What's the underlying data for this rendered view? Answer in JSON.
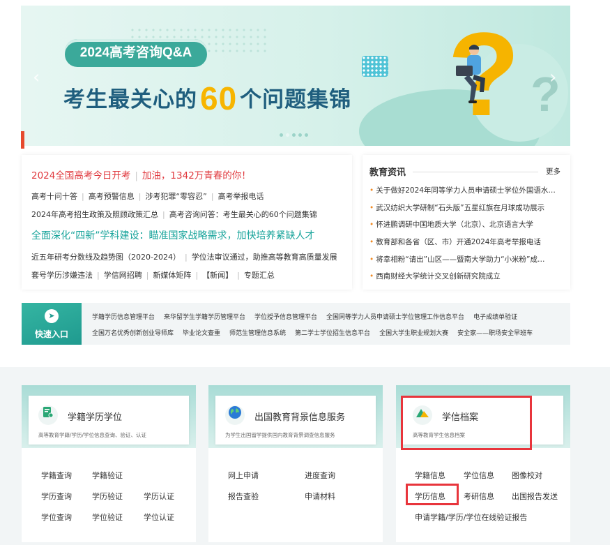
{
  "banner": {
    "tag": "2024高考咨询Q&A",
    "title_pre": "考生最关心的",
    "title_num": "60",
    "title_post": "个问题集锦",
    "prev": "‹",
    "next": "›",
    "slide_count": 5,
    "active_slide": 2
  },
  "news": {
    "headline1_a": "2024全国高考今日开考",
    "headline1_sep": "|",
    "headline1_b": "加油，1342万青春的你！",
    "row1": [
      "高考十问十答",
      "高考预警信息",
      "涉考犯罪“零容忍”",
      "高考举报电话"
    ],
    "row2": [
      "2024年高考招生政策及照顾政策汇总",
      "高考咨询问答：考生最关心的60个问题集锦"
    ],
    "headline2": "全面深化“四新”学科建设：瞄准国家战略需求，加快培养紧缺人才",
    "row3": [
      "近五年研考分数线及趋势图（2020-2024）",
      "学位法审议通过，助推高等教育高质量发展"
    ],
    "row4": [
      "套号学历涉嫌违法",
      "学信网招聘",
      "新媒体矩阵",
      "【新闻】",
      "专题汇总"
    ]
  },
  "edu": {
    "title": "教育资讯",
    "more": "更多",
    "items": [
      "关于做好2024年同等学力人员申请硕士学位外国语水…",
      "武汉纺织大学研制“石头版”五星红旗在月球成功展示",
      "怀进鹏调研中国地质大学（北京）、北京语言大学",
      "教育部和各省（区、市）开通2024年高考举报电话",
      "将幸相粉“请出”山区——暨南大学助力“小米粉”成…",
      "西南财经大学统计交叉创新研究院成立"
    ]
  },
  "quick": {
    "label": "快速入口",
    "row1": [
      "学籍学历信息管理平台",
      "来华留学生学籍学历管理平台",
      "学位授予信息管理平台",
      "全国同等学力人员申请硕士学位管理工作信息平台",
      "电子成绩单验证"
    ],
    "row2": [
      "全国万名优秀创新创业导师库",
      "毕业论文查重",
      "师范生管理信息系统",
      "第二学士学位招生信息平台",
      "全国大学生职业规划大赛",
      "安全家——职场安全早班车"
    ]
  },
  "cards": [
    {
      "title": "学籍学历学位",
      "subtitle": "高等教育学籍/学历/学位信息查询、验证、认证",
      "links": [
        "学籍查询",
        "学籍验证",
        "学历查询",
        "学历验证",
        "学历认证",
        "学位查询",
        "学位验证",
        "学位认证"
      ]
    },
    {
      "title": "出国教育背景信息服务",
      "subtitle": "为学生出国留学提供国内教育背景调查信息服务",
      "links": [
        "网上申请",
        "进度查询",
        "报告查验",
        "申请材料"
      ]
    },
    {
      "title": "学信档案",
      "subtitle": "高等教育学生信息档案",
      "links": [
        "学籍信息",
        "学位信息",
        "图像校对",
        "学历信息",
        "考研信息",
        "出国报告发送",
        "申请学籍/学历/学位在线验证报告"
      ]
    }
  ],
  "colors": {
    "accent": "#1f9a8f",
    "headline_red": "#e0393e",
    "headline_teal": "#16a39a",
    "banner_yellow": "#f7b500",
    "highlight_red": "#e8353c"
  }
}
